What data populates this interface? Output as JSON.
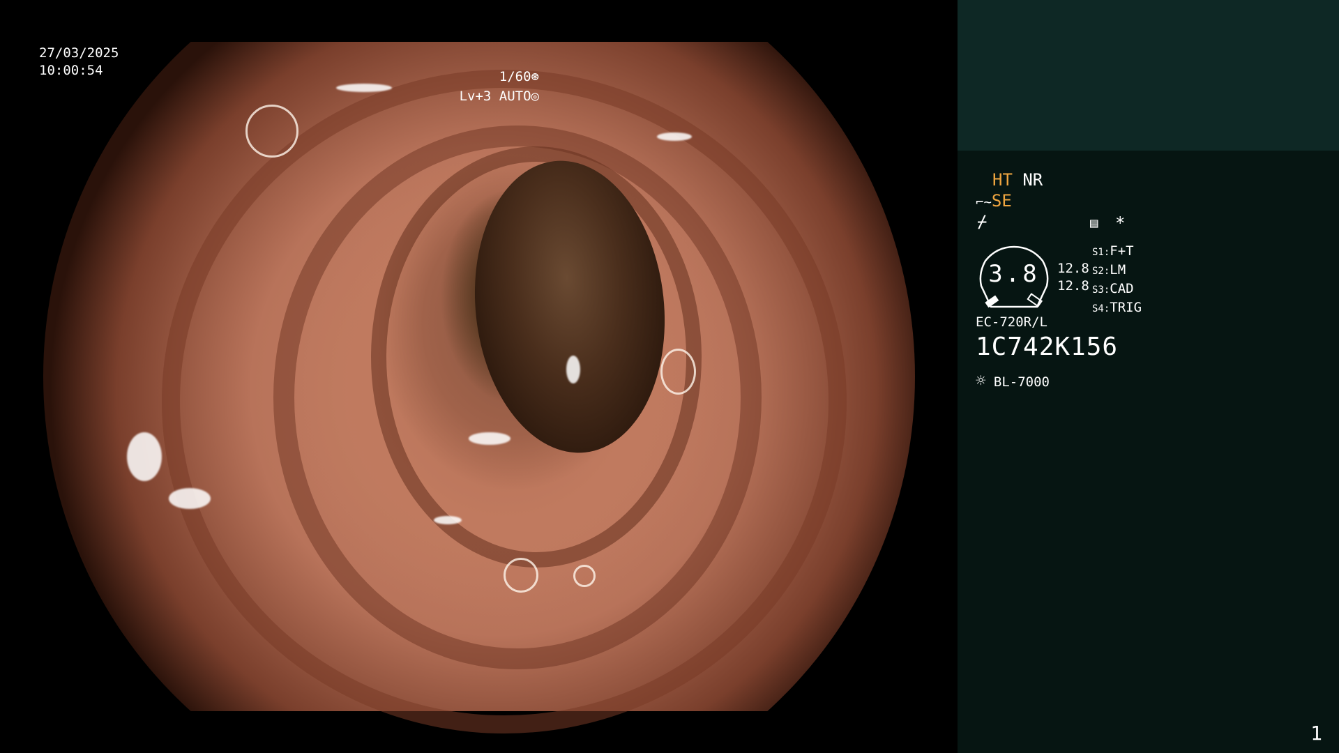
{
  "video": {
    "date": "27/03/2025",
    "time": "10:00:54",
    "shutter": "1/60",
    "level": "Lv+3",
    "iris_mode": "AUTO"
  },
  "panel": {
    "ht": "HT",
    "nr": "NR",
    "se": "SE",
    "asterisk": "*",
    "zoom_value": "3.8",
    "val_1": "12.8",
    "val_2": "12.8",
    "switches": [
      {
        "key": "S1",
        "value": "F+T"
      },
      {
        "key": "S2",
        "value": "LM"
      },
      {
        "key": "S3",
        "value": "CAD"
      },
      {
        "key": "S4",
        "value": "TRIG"
      }
    ],
    "scope_model": "EC-720R/L",
    "scope_id": "1C742K156",
    "light_source": "BL-7000",
    "page_number": "1"
  },
  "colors": {
    "panel_bg": "#061512",
    "panel_top_bg": "#0e2825",
    "accent_orange": "#f0a640"
  },
  "icons": [
    "aperture-icon",
    "iris-icon",
    "structure-enhance-icon",
    "freeze-icon",
    "menu-icon",
    "light-source-icon"
  ]
}
